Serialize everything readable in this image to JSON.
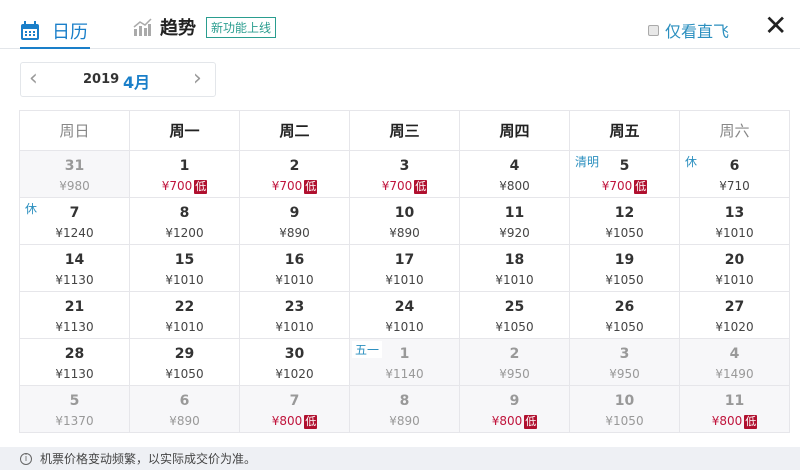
{
  "header": {
    "tab_calendar": "日历",
    "tab_trend": "趋势",
    "new_badge": "新功能上线",
    "direct_only": "仅看直飞",
    "close": "✕"
  },
  "nav": {
    "year": "2019",
    "month": "4月",
    "prev": "‹",
    "next": "›"
  },
  "weekdays": [
    "周日",
    "周一",
    "周二",
    "周三",
    "周四",
    "周五",
    "周六"
  ],
  "low_label": "低",
  "weeks": [
    [
      {
        "d": "31",
        "p": "¥980",
        "out": true
      },
      {
        "d": "1",
        "p": "¥700",
        "low": true
      },
      {
        "d": "2",
        "p": "¥700",
        "low": true
      },
      {
        "d": "3",
        "p": "¥700",
        "low": true
      },
      {
        "d": "4",
        "p": "¥800"
      },
      {
        "d": "5",
        "p": "¥700",
        "low": true,
        "tag": "清明"
      },
      {
        "d": "6",
        "p": "¥710",
        "tag": "休"
      }
    ],
    [
      {
        "d": "7",
        "p": "¥1240",
        "tag": "休"
      },
      {
        "d": "8",
        "p": "¥1200"
      },
      {
        "d": "9",
        "p": "¥890"
      },
      {
        "d": "10",
        "p": "¥890"
      },
      {
        "d": "11",
        "p": "¥920"
      },
      {
        "d": "12",
        "p": "¥1050"
      },
      {
        "d": "13",
        "p": "¥1010"
      }
    ],
    [
      {
        "d": "14",
        "p": "¥1130"
      },
      {
        "d": "15",
        "p": "¥1010"
      },
      {
        "d": "16",
        "p": "¥1010"
      },
      {
        "d": "17",
        "p": "¥1010"
      },
      {
        "d": "18",
        "p": "¥1010"
      },
      {
        "d": "19",
        "p": "¥1050"
      },
      {
        "d": "20",
        "p": "¥1010"
      }
    ],
    [
      {
        "d": "21",
        "p": "¥1130"
      },
      {
        "d": "22",
        "p": "¥1010"
      },
      {
        "d": "23",
        "p": "¥1010"
      },
      {
        "d": "24",
        "p": "¥1010"
      },
      {
        "d": "25",
        "p": "¥1050"
      },
      {
        "d": "26",
        "p": "¥1050"
      },
      {
        "d": "27",
        "p": "¥1020"
      }
    ],
    [
      {
        "d": "28",
        "p": "¥1130"
      },
      {
        "d": "29",
        "p": "¥1050"
      },
      {
        "d": "30",
        "p": "¥1020"
      },
      {
        "d": "1",
        "p": "¥1140",
        "out": true,
        "tag": "五一"
      },
      {
        "d": "2",
        "p": "¥950",
        "out": true
      },
      {
        "d": "3",
        "p": "¥950",
        "out": true
      },
      {
        "d": "4",
        "p": "¥1490",
        "out": true
      }
    ],
    [
      {
        "d": "5",
        "p": "¥1370",
        "out": true
      },
      {
        "d": "6",
        "p": "¥890",
        "out": true
      },
      {
        "d": "7",
        "p": "¥800",
        "out": true,
        "low": true
      },
      {
        "d": "8",
        "p": "¥890",
        "out": true
      },
      {
        "d": "9",
        "p": "¥800",
        "out": true,
        "low": true
      },
      {
        "d": "10",
        "p": "¥1050",
        "out": true
      },
      {
        "d": "11",
        "p": "¥800",
        "out": true,
        "low": true
      }
    ]
  ],
  "footer": {
    "icon": "i",
    "notice": "机票价格变动频繁，以实际成交价为准。"
  },
  "colors": {
    "accent": "#1a7fc9",
    "low_price": "#c0143c",
    "low_badge": "#b0102f"
  }
}
